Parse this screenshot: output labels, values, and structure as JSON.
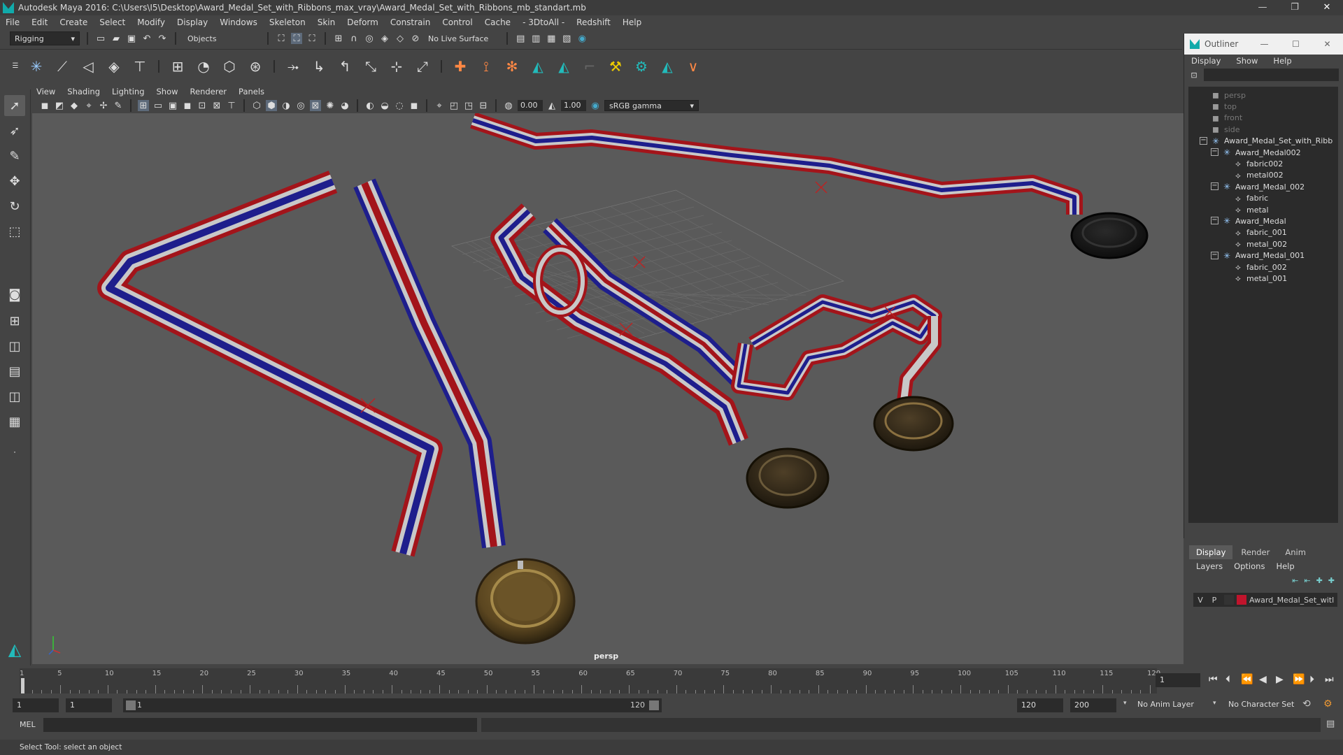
{
  "window": {
    "title": "Autodesk Maya 2016: C:\\Users\\I5\\Desktop\\Award_Medal_Set_with_Ribbons_max_vray\\Award_Medal_Set_with_Ribbons_mb_standart.mb",
    "minimize": "—",
    "maximize": "❐",
    "close": "✕"
  },
  "menubar": [
    "File",
    "Edit",
    "Create",
    "Select",
    "Modify",
    "Display",
    "Windows",
    "Skeleton",
    "Skin",
    "Deform",
    "Constrain",
    "Control",
    "Cache",
    "- 3DtoAll -",
    "Redshift",
    "Help"
  ],
  "statusline": {
    "menuset": "Rigging",
    "selection_mode": "Objects",
    "live_surface": "No Live Surface"
  },
  "viewport": {
    "menu": [
      "View",
      "Shading",
      "Lighting",
      "Show",
      "Renderer",
      "Panels"
    ],
    "exposure": "0.00",
    "gamma": "1.00",
    "color_space": "sRGB gamma",
    "camera_label": "persp"
  },
  "outliner": {
    "title": "Outliner",
    "menu": [
      "Display",
      "Show",
      "Help"
    ],
    "items": [
      {
        "label": "persp",
        "icon": "camera-icon",
        "dim": true
      },
      {
        "label": "top",
        "icon": "camera-icon",
        "dim": true
      },
      {
        "label": "front",
        "icon": "camera-icon",
        "dim": true
      },
      {
        "label": "side",
        "icon": "camera-icon",
        "dim": true
      },
      {
        "label": "Award_Medal_Set_with_Ribb",
        "icon": "group-icon",
        "dim": false
      },
      {
        "label": "Award_Medal002",
        "icon": "group-icon",
        "dim": false
      },
      {
        "label": "fabric002",
        "icon": "mesh-icon",
        "dim": false
      },
      {
        "label": "metal002",
        "icon": "mesh-icon",
        "dim": false
      },
      {
        "label": "Award_Medal_002",
        "icon": "group-icon",
        "dim": false
      },
      {
        "label": "fabric",
        "icon": "mesh-icon",
        "dim": false
      },
      {
        "label": "metal",
        "icon": "mesh-icon",
        "dim": false
      },
      {
        "label": "Award_Medal",
        "icon": "group-icon",
        "dim": false
      },
      {
        "label": "fabric_001",
        "icon": "mesh-icon",
        "dim": false
      },
      {
        "label": "metal_002",
        "icon": "mesh-icon",
        "dim": false
      },
      {
        "label": "Award_Medal_001",
        "icon": "group-icon",
        "dim": false
      },
      {
        "label": "fabric_002",
        "icon": "mesh-icon",
        "dim": false
      },
      {
        "label": "metal_001",
        "icon": "mesh-icon",
        "dim": false
      }
    ]
  },
  "layers": {
    "tabs": [
      "Display",
      "Render",
      "Anim"
    ],
    "menu": [
      "Layers",
      "Options",
      "Help"
    ],
    "row": {
      "visible": "V",
      "playback": "P",
      "name": "Award_Medal_Set_witl",
      "color": "#c0142c"
    }
  },
  "timeline": {
    "ticks": [
      "1",
      "5",
      "10",
      "15",
      "20",
      "25",
      "30",
      "35",
      "40",
      "45",
      "50",
      "55",
      "60",
      "65",
      "70",
      "75",
      "80",
      "85",
      "90",
      "95",
      "100",
      "105",
      "110",
      "115",
      "120"
    ],
    "current_frame": "1"
  },
  "range": {
    "start": "1",
    "playback_start": "1",
    "slider_start": "1",
    "slider_end": "120",
    "playback_end": "120",
    "end": "200",
    "anim_layer": "No Anim Layer",
    "character_set": "No Character Set"
  },
  "command": {
    "language": "MEL"
  },
  "helpline": "Select Tool: select an object",
  "colors": {
    "ribbon_red": "#a3141a",
    "ribbon_white": "#c8c8c8",
    "ribbon_blue": "#1e1e8c",
    "gold": "#8a6a2a",
    "bronze": "#4a3a22",
    "dark_medal": "#1c1c1c"
  }
}
